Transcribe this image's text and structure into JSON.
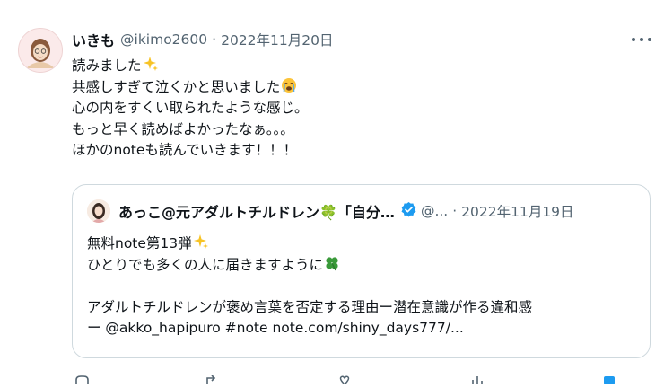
{
  "tweet": {
    "display_name": "いきも",
    "handle": "@ikimo2600",
    "separator": "·",
    "date": "2022年11月20日",
    "lines": [
      "読みました",
      "共感しすぎて泣くかと思いました",
      "心の内をすくい取られたような感じ。",
      "もっと早く読めばよかったなぁ。。。",
      "ほかのnoteも読んでいきます！！！"
    ],
    "line_emojis": [
      "sparkles-emoji",
      "crying-face-emoji",
      "",
      "",
      ""
    ]
  },
  "quote": {
    "display_name": "あっこ@元アダルトチルドレン🍀「自分…",
    "handle": "@...",
    "separator": "·",
    "date": "2022年11月19日",
    "lines": [
      "無料note第13弾",
      "ひとりでも多くの人に届きますように",
      "",
      "アダルトチルドレンが褒め言葉を否定する理由ー潜在意識が作る違和感",
      "ー @akko_hapipuro #note note.com/shiny_days777/..."
    ]
  },
  "colors": {
    "text": "#0f1419",
    "muted": "#536471",
    "border": "#cfd9de",
    "verified": "#1d9bf0",
    "clover": "#3a9a3a",
    "sparkle": "#f7c325"
  },
  "icons": [
    "more-icon",
    "verified-badge-icon",
    "clover-emoji",
    "sparkles-emoji",
    "crying-face-emoji",
    "reply-icon",
    "retweet-icon",
    "like-icon",
    "views-icon",
    "bookmark-icon"
  ]
}
